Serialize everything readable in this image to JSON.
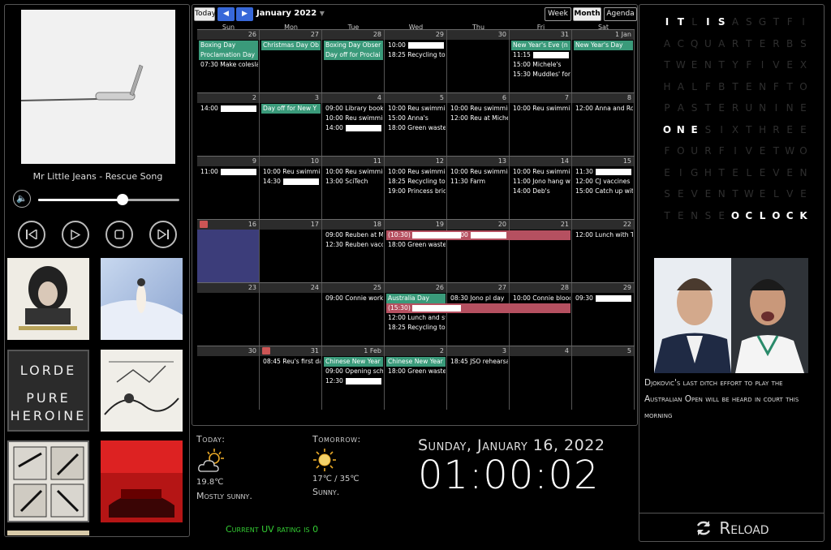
{
  "player": {
    "track": "Mr Little Jeans - Rescue Song",
    "volume_level": 0.6,
    "album_covers": [
      "clairy-browne-cover",
      "snowy-dancer-cover",
      "lorde-pure-heroine-cover",
      "sketch-horse-cover",
      "paper-collage-cover",
      "red-car-cover"
    ],
    "lorde_text": "LORDE",
    "pure_text": "PURE",
    "heroine_text": "HEROINE"
  },
  "calendar": {
    "today_label": "Today",
    "prev_label": "◀",
    "next_label": "▶",
    "month_title": "January 2022",
    "view_buttons": [
      "Week",
      "Month",
      "Agenda"
    ],
    "weekdays": [
      "Sun",
      "Mon",
      "Tue",
      "Wed",
      "Thu",
      "Fri",
      "Sat"
    ],
    "weeks": [
      [
        "26",
        "27",
        "28",
        "29",
        "30",
        "31",
        "1 Jan"
      ],
      [
        "2",
        "3",
        "4",
        "5",
        "6",
        "7",
        "8"
      ],
      [
        "9",
        "10",
        "11",
        "12",
        "13",
        "14",
        "15"
      ],
      [
        "16",
        "17",
        "18",
        "19",
        "20",
        "21",
        "22"
      ],
      [
        "23",
        "24",
        "25",
        "26",
        "27",
        "28",
        "29"
      ],
      [
        "30",
        "31",
        "1 Feb",
        "2",
        "3",
        "4",
        "5"
      ]
    ],
    "events": {
      "w0": {
        "sun": [
          "Boxing Day",
          "Proclamation Day",
          "07:30 Make coleslaw"
        ],
        "mon": [
          "Christmas Day Ob"
        ],
        "tue": [
          "Boxing Day Obser",
          "Day off for Proclai"
        ],
        "wed": [
          "10:00",
          "18:25 Recycling tom"
        ],
        "fri": [
          "New Year's Eve (n",
          "11:15",
          "15:00 Michele's",
          "15:30 Muddles' for s"
        ],
        "sat": [
          "New Year's Day"
        ]
      },
      "w1": {
        "sun": [
          "14:00"
        ],
        "mon": [
          "Day off for New Y"
        ],
        "tue": [
          "09:00 Library books",
          "10:00 Reu swimmin",
          "14:00"
        ],
        "wed": [
          "10:00 Reu swimmin",
          "15:00 Anna's",
          "18:00 Green waste c"
        ],
        "thu": [
          "10:00 Reu swimmin",
          "12:00 Reu at Michel"
        ],
        "fri": [
          "10:00 Reu swimmin"
        ],
        "sat": [
          "12:00 Anna and Ror"
        ]
      },
      "w2": {
        "sun": [
          "11:00"
        ],
        "mon": [
          "10:00 Reu swimmin",
          "14:30"
        ],
        "tue": [
          "10:00 Reu swimmin",
          "13:00 SciTech"
        ],
        "wed": [
          "10:00 Reu swimmin",
          "18:25 Recycling tom",
          "19:00 Princess bride"
        ],
        "thu": [
          "10:00 Reu swimmin",
          "11:30 Farm"
        ],
        "fri": [
          "10:00 Reu swimmin",
          "11:00 Jono hang wi",
          "14:00 Deb's"
        ],
        "sat": [
          "11:30",
          "12:00 CJ vaccines",
          "15:00 Catch up with"
        ]
      },
      "w3": {
        "tue": [
          "09:00 Reuben at Mic",
          "12:30 Reuben vacci"
        ],
        "wed_span": "(10:30)",
        "wed": [
          "18:00 Green waste c"
        ],
        "thu": [
          "08:00"
        ],
        "sat": [
          "12:00 Lunch with Ta"
        ]
      },
      "w4": {
        "tue": [
          "09:00 Connie work"
        ],
        "wed_green": "Australia Day",
        "wed_span": "(15:30)",
        "wed": [
          "12:00 Lunch and sw",
          "18:25 Recycling tom"
        ],
        "thu": [
          "08:30 Jono pl day"
        ],
        "fri": [
          "10:00 Connie blood"
        ],
        "sat": [
          "09:30"
        ]
      },
      "w5": {
        "mon": [
          "08:45 Reu's first day"
        ],
        "tue": [
          "Chinese New Year",
          "09:00 Opening scho",
          "12:30"
        ],
        "wed": [
          "Chinese New Year",
          "18:00 Green waste c"
        ],
        "thu": [
          "18:45 JSO rehearsal"
        ]
      }
    }
  },
  "weather": {
    "today_label": "Today:",
    "today_temp": "19.8℃",
    "today_desc": "Mostly sunny.",
    "tomorrow_label": "Tomorrow:",
    "tomorrow_temp": "17℃ / 35℃",
    "tomorrow_desc": "Sunny.",
    "uv_text": "Current UV rating is 0",
    "today_icon": "partly-cloudy-icon",
    "tomorrow_icon": "sun-icon"
  },
  "clock": {
    "date": "Sunday, January 16, 2022",
    "time": "01:00:02"
  },
  "word_clock": {
    "rows": [
      "ITLISASGTFI",
      "ACQUARTERBS",
      "TWENTYFIVEX",
      "HALFBTENFTO",
      "PASTERUNINE",
      "ONESIXTHREE",
      "FOURFIVETWO",
      "EIGHTELEVEN",
      "SEVENTWELVE",
      "TENSEOCLOCK"
    ],
    "lit_text": "IT IS ONE OCLOCK"
  },
  "news": {
    "headline": "Djokovic's last ditch effort to play the Australian Open will be heard in court this morning"
  },
  "reload_label": "Reload",
  "colors": {
    "event_green": "#3a9a7a",
    "event_red": "#b55060",
    "uv_green": "#33cc33",
    "today_cell": "#3c3d7a"
  }
}
